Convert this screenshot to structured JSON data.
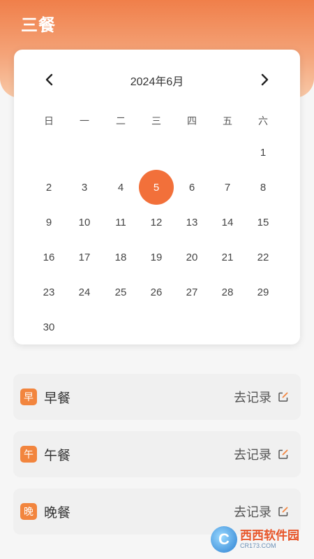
{
  "app": {
    "title": "三餐"
  },
  "calendar": {
    "month_label": "2024年6月",
    "weekdays": [
      "日",
      "一",
      "二",
      "三",
      "四",
      "五",
      "六"
    ],
    "selected_day": 5,
    "rows": [
      [
        "",
        "",
        "",
        "",
        "",
        "",
        "1"
      ],
      [
        "2",
        "3",
        "4",
        "5",
        "6",
        "7",
        "8"
      ],
      [
        "9",
        "10",
        "11",
        "12",
        "13",
        "14",
        "15"
      ],
      [
        "16",
        "17",
        "18",
        "19",
        "20",
        "21",
        "22"
      ],
      [
        "23",
        "24",
        "25",
        "26",
        "27",
        "28",
        "29"
      ],
      [
        "30",
        "",
        "",
        "",
        "",
        "",
        ""
      ]
    ],
    "icons": {
      "prev": "chevron-left-icon",
      "next": "chevron-right-icon"
    }
  },
  "meals": [
    {
      "badge": "早",
      "name": "早餐",
      "action": "去记录",
      "icon": "edit-icon"
    },
    {
      "badge": "午",
      "name": "午餐",
      "action": "去记录",
      "icon": "edit-icon"
    },
    {
      "badge": "晚",
      "name": "晚餐",
      "action": "去记录",
      "icon": "edit-icon"
    }
  ],
  "watermark": {
    "logo": "C",
    "main": "西西软件园",
    "sub": "CR173.COM"
  },
  "colors": {
    "accent": "#f2703a",
    "header_top": "#f07f4a",
    "badge": "#f2853e"
  }
}
